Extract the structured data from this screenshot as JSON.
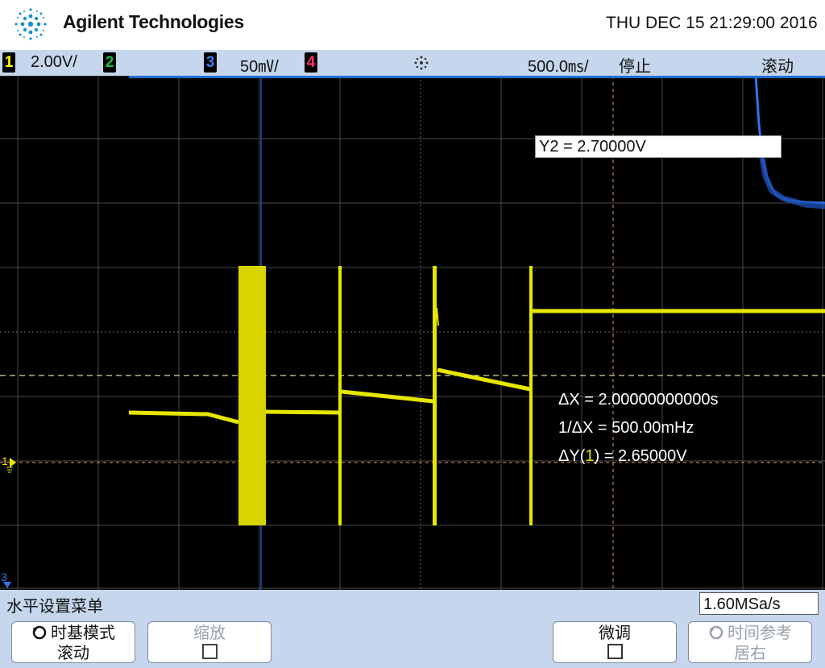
{
  "header": {
    "brand": "Agilent Technologies",
    "datetime": "THU DEC 15 21:29:00 2016"
  },
  "status_bar": {
    "ch1": {
      "num": "1",
      "scale": "2.00V/",
      "color": "#ffff00"
    },
    "ch2": {
      "num": "2",
      "color": "#20c040"
    },
    "ch3": {
      "num": "3",
      "scale": "50㎷/",
      "color": "#3a7ff0"
    },
    "ch4": {
      "num": "4",
      "color": "#ff3070"
    },
    "timebase": "500.0㎳/",
    "run_state": "停止",
    "mode": "滚动"
  },
  "screen": {
    "y2_readout": "Y2 = 2.70000V",
    "delta_x": "ΔX = 2.00000000000s",
    "inv_delta_x": "1/ΔX = 500.00mHz",
    "delta_y_prefix": "ΔY(",
    "delta_y_ch": "1",
    "delta_y_suffix": ") = 2.65000V",
    "ch1_marker": "1",
    "ch3_marker": "3"
  },
  "menu": {
    "title": "水平设置菜单",
    "sample_rate": "1.60MSa/s",
    "softkeys": [
      {
        "line1": "时基模式",
        "line2": "滚动",
        "enabled": true
      },
      {
        "line1": "缩放",
        "line2": "",
        "enabled": false
      },
      {
        "line1": "微调",
        "line2": "",
        "enabled": true
      },
      {
        "line1": "时间参考",
        "line2": "居右",
        "enabled": false
      }
    ]
  },
  "colors": {
    "trace_ch1": "#e6e600",
    "trace_ch3": "#2f74e8",
    "grid": "#4a4a4a",
    "panel": "#c6d6ec"
  }
}
